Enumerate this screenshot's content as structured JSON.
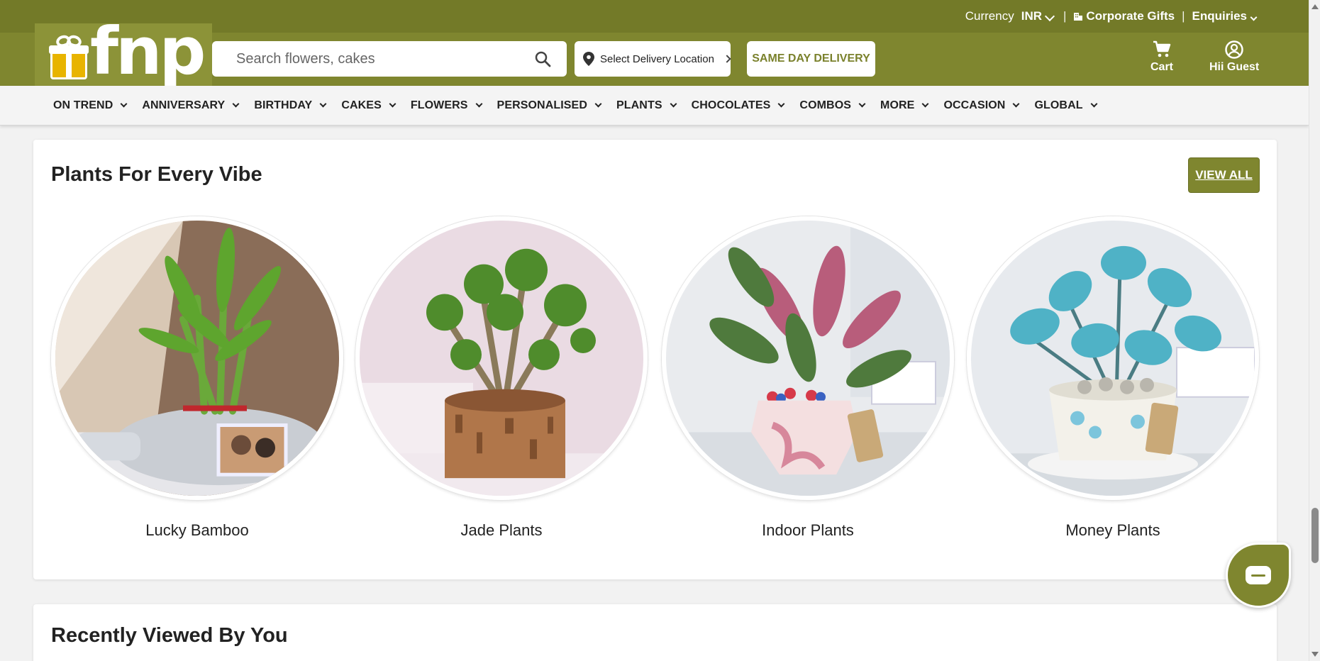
{
  "brand": {
    "name": "fnp",
    "primary_color": "#7f862f",
    "accent_color": "#e8b400"
  },
  "topbar": {
    "currency_label": "Currency",
    "currency_value": "INR",
    "corporate_gifts": "Corporate Gifts",
    "enquiries": "Enquiries",
    "separator": "|"
  },
  "header": {
    "search_placeholder": "Search flowers, cakes",
    "location_label": "Select Delivery Location",
    "same_day_label": "SAME DAY DELIVERY",
    "cart_label": "Cart",
    "guest_label": "Hii Guest"
  },
  "nav": {
    "items": [
      {
        "label": "ON TREND"
      },
      {
        "label": "ANNIVERSARY"
      },
      {
        "label": "BIRTHDAY"
      },
      {
        "label": "CAKES"
      },
      {
        "label": "FLOWERS"
      },
      {
        "label": "PERSONALISED"
      },
      {
        "label": "PLANTS"
      },
      {
        "label": "CHOCOLATES"
      },
      {
        "label": "COMBOS"
      },
      {
        "label": "MORE"
      },
      {
        "label": "OCCASION"
      },
      {
        "label": "GLOBAL"
      }
    ]
  },
  "plants_section": {
    "title": "Plants For Every Vibe",
    "view_all": "VIEW ALL",
    "tiles": [
      {
        "label": "Lucky Bamboo"
      },
      {
        "label": "Jade Plants"
      },
      {
        "label": "Indoor Plants"
      },
      {
        "label": "Money Plants"
      }
    ]
  },
  "recent_section": {
    "title": "Recently Viewed By You"
  },
  "icons": {
    "search": "search-icon",
    "location": "location-pin-icon",
    "cart": "cart-icon",
    "user": "user-icon",
    "chat": "chat-icon"
  }
}
